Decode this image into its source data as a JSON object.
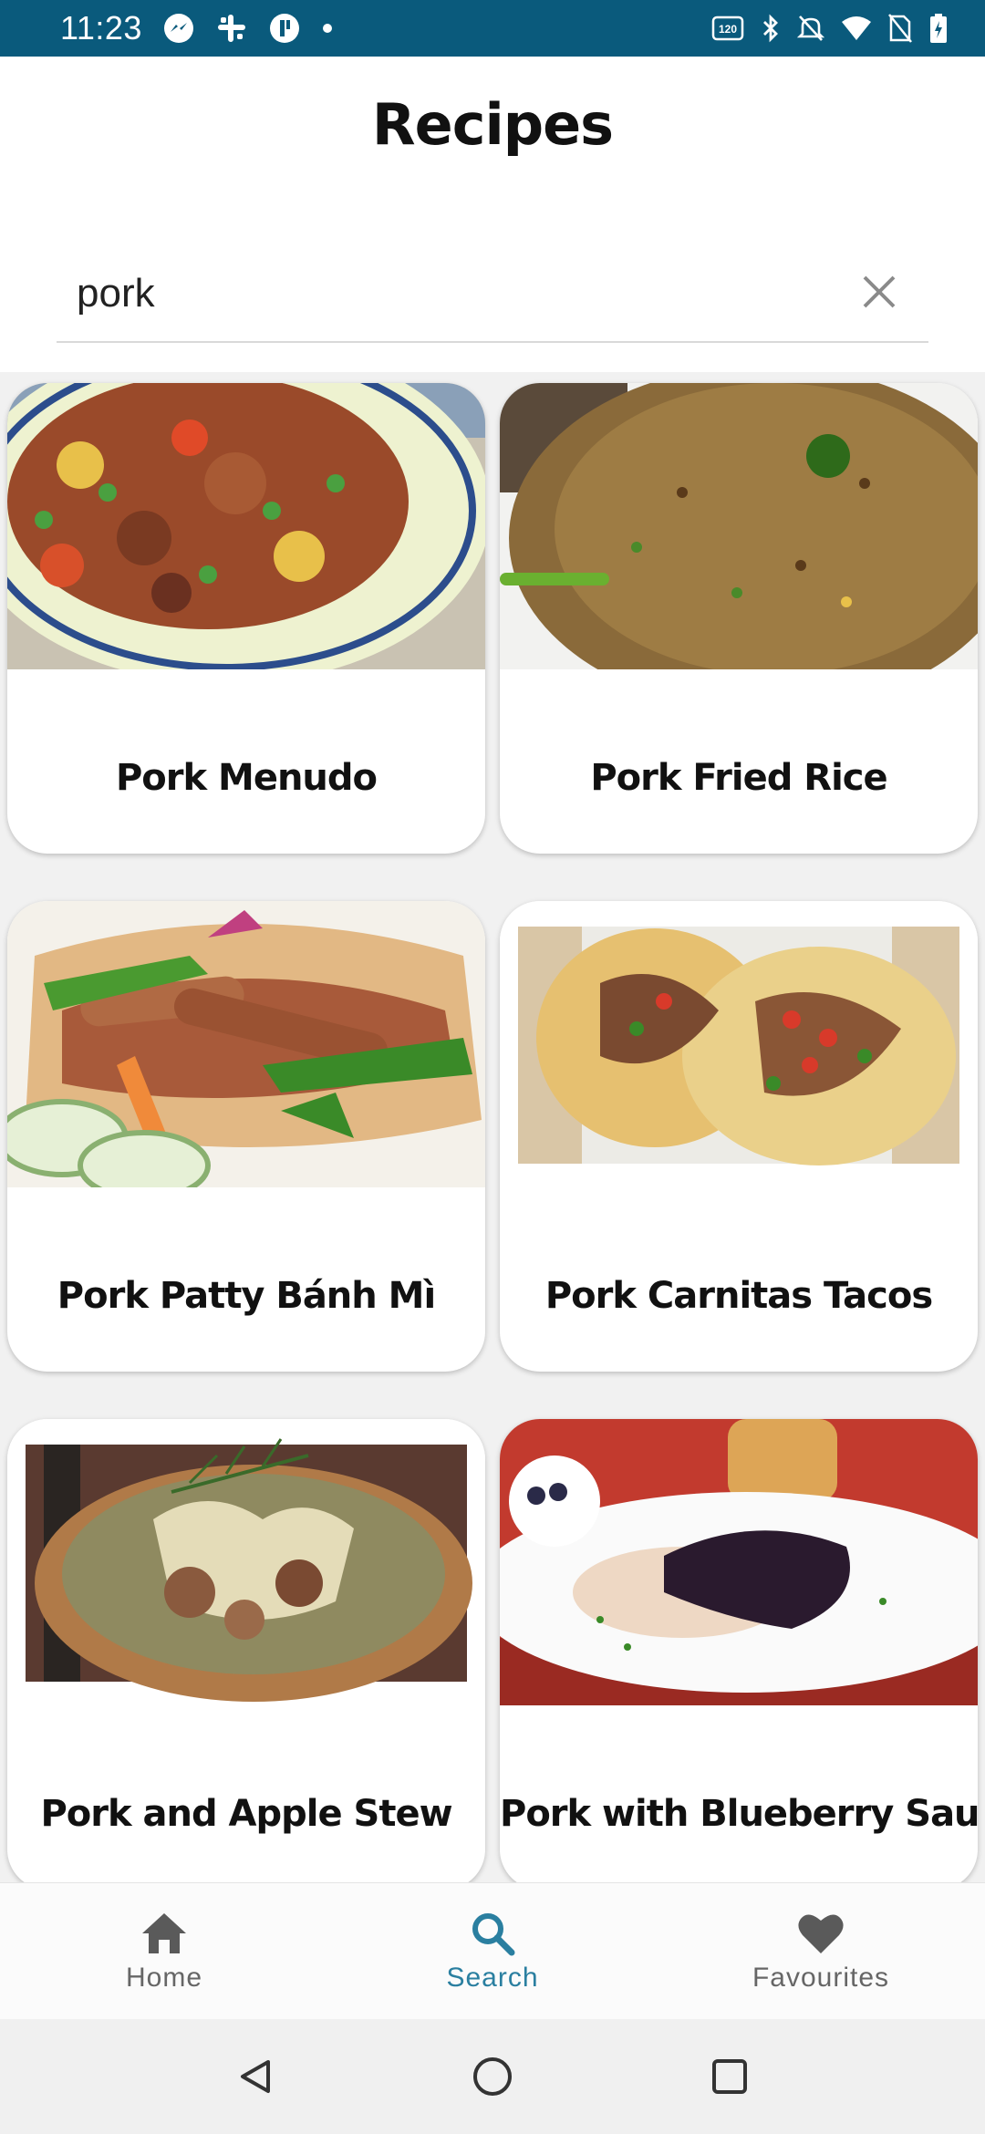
{
  "status_bar": {
    "time": "11:23",
    "left_icons": [
      "messenger-icon",
      "slack-icon",
      "app-icon",
      "dot-icon"
    ],
    "right_icons": [
      "refresh-rate-icon",
      "bluetooth-icon",
      "mute-icon",
      "wifi-icon",
      "no-sim-icon",
      "battery-icon"
    ],
    "refresh_rate": "120Hz"
  },
  "header": {
    "title": "Recipes"
  },
  "search": {
    "value": "pork",
    "placeholder": ""
  },
  "recipes": [
    {
      "title": "Pork Menudo"
    },
    {
      "title": "Pork Fried Rice"
    },
    {
      "title": "Pork Patty Bánh Mì"
    },
    {
      "title": "Pork Carnitas Tacos"
    },
    {
      "title": "Pork and Apple Stew"
    },
    {
      "title": "Pork with Blueberry Sauce"
    }
  ],
  "bottom_nav": {
    "items": [
      {
        "label": "Home",
        "icon": "home-icon",
        "active": false
      },
      {
        "label": "Search",
        "icon": "search-icon",
        "active": true
      },
      {
        "label": "Favourites",
        "icon": "heart-icon",
        "active": false
      }
    ]
  },
  "colors": {
    "status_bar": "#0a5a7c",
    "accent": "#2a7fa0",
    "nav_inactive": "#666666"
  }
}
